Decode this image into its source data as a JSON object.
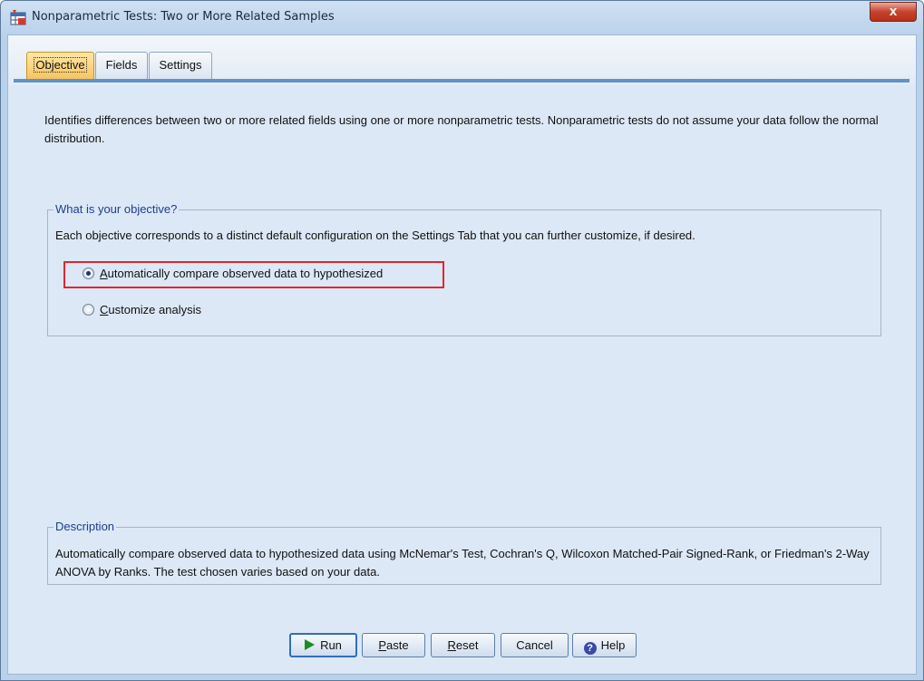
{
  "window": {
    "title": "Nonparametric Tests: Two or More Related Samples",
    "close_glyph": "x"
  },
  "tabs": [
    {
      "label": "Objective",
      "active": true
    },
    {
      "label": "Fields",
      "active": false
    },
    {
      "label": "Settings",
      "active": false
    }
  ],
  "intro": "Identifies differences between two or more related fields using one or more nonparametric tests. Nonparametric tests do not assume your data follow the normal distribution.",
  "objective_group": {
    "legend": "What is your objective?",
    "description": "Each objective corresponds to a distinct default configuration on the Settings Tab that you can further customize, if desired.",
    "options": [
      {
        "mnemonic": "A",
        "rest": "utomatically compare observed data to hypothesized",
        "checked": true,
        "prefix": ""
      },
      {
        "mnemonic": "C",
        "rest": "ustomize analysis",
        "checked": false,
        "prefix": ""
      }
    ]
  },
  "description_group": {
    "legend": "Description",
    "text": "Automatically compare observed data to hypothesized data using McNemar's Test, Cochran's Q, Wilcoxon Matched-Pair Signed-Rank, or Friedman's 2-Way ANOVA by Ranks.  The test chosen varies based on your data."
  },
  "buttons": {
    "run": "Run",
    "paste_mn": "P",
    "paste_rest": "aste",
    "reset_mn": "R",
    "reset_rest": "eset",
    "cancel": "Cancel",
    "help": "Help"
  },
  "icons": {
    "app": "spss-table-icon",
    "run": "play-icon",
    "help": "question-icon"
  },
  "colors": {
    "active_tab": "#f9c45d",
    "highlight": "#e0262e",
    "run_arrow": "#1b8c25",
    "legend_text": "#1c3f8f"
  }
}
